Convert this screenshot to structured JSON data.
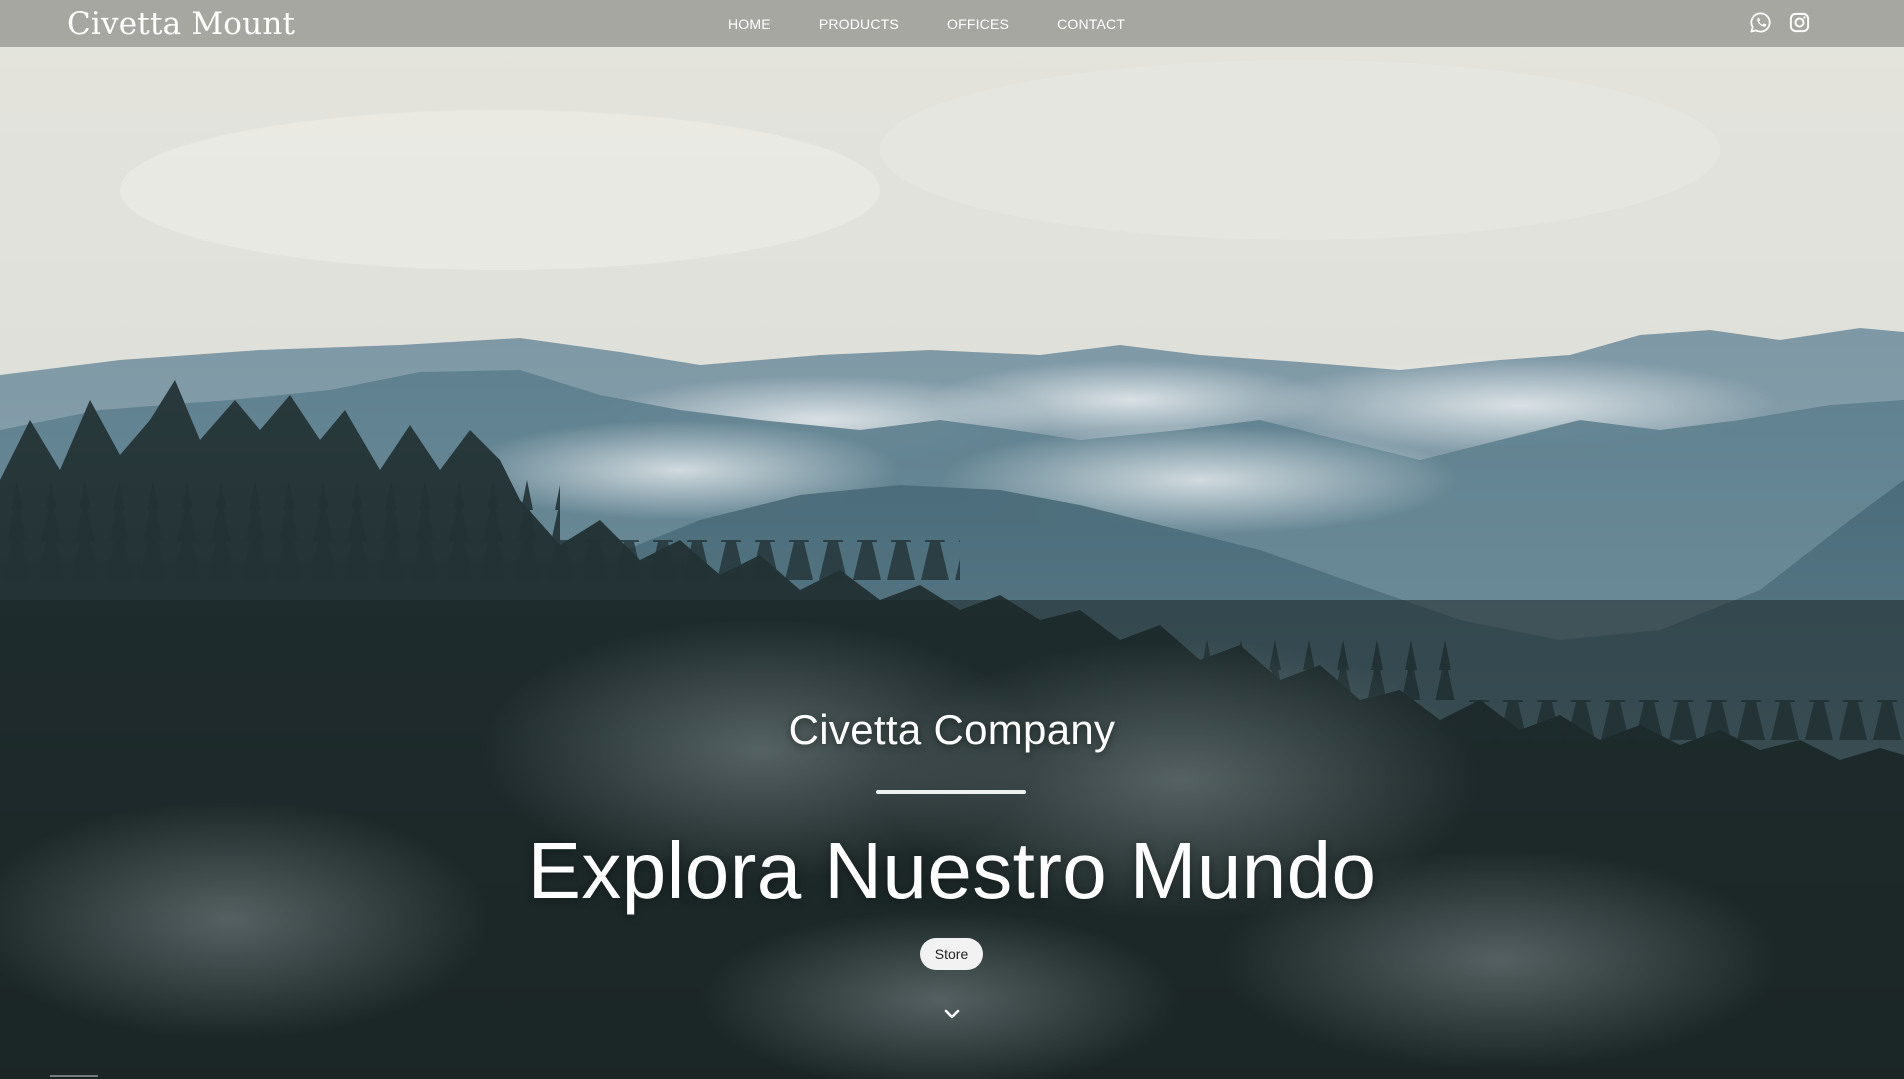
{
  "navbar": {
    "brand": "Civetta Mount",
    "links": [
      "HOME",
      "PRODUCTS",
      "OFFICES",
      "CONTACT"
    ],
    "social": [
      "whatsapp-icon",
      "instagram-icon"
    ],
    "background": "#9a9a95"
  },
  "hero": {
    "company": "Civetta Company",
    "headline": "Explora Nuestro Mundo",
    "button_label": "Store",
    "scroll_icon": "chevron-down-icon",
    "colors": {
      "sky": "#e6e6e0",
      "far_mountains": "#6f8f9f",
      "mid_mountains": "#4f7282",
      "forest": "#1f2c2d"
    }
  }
}
